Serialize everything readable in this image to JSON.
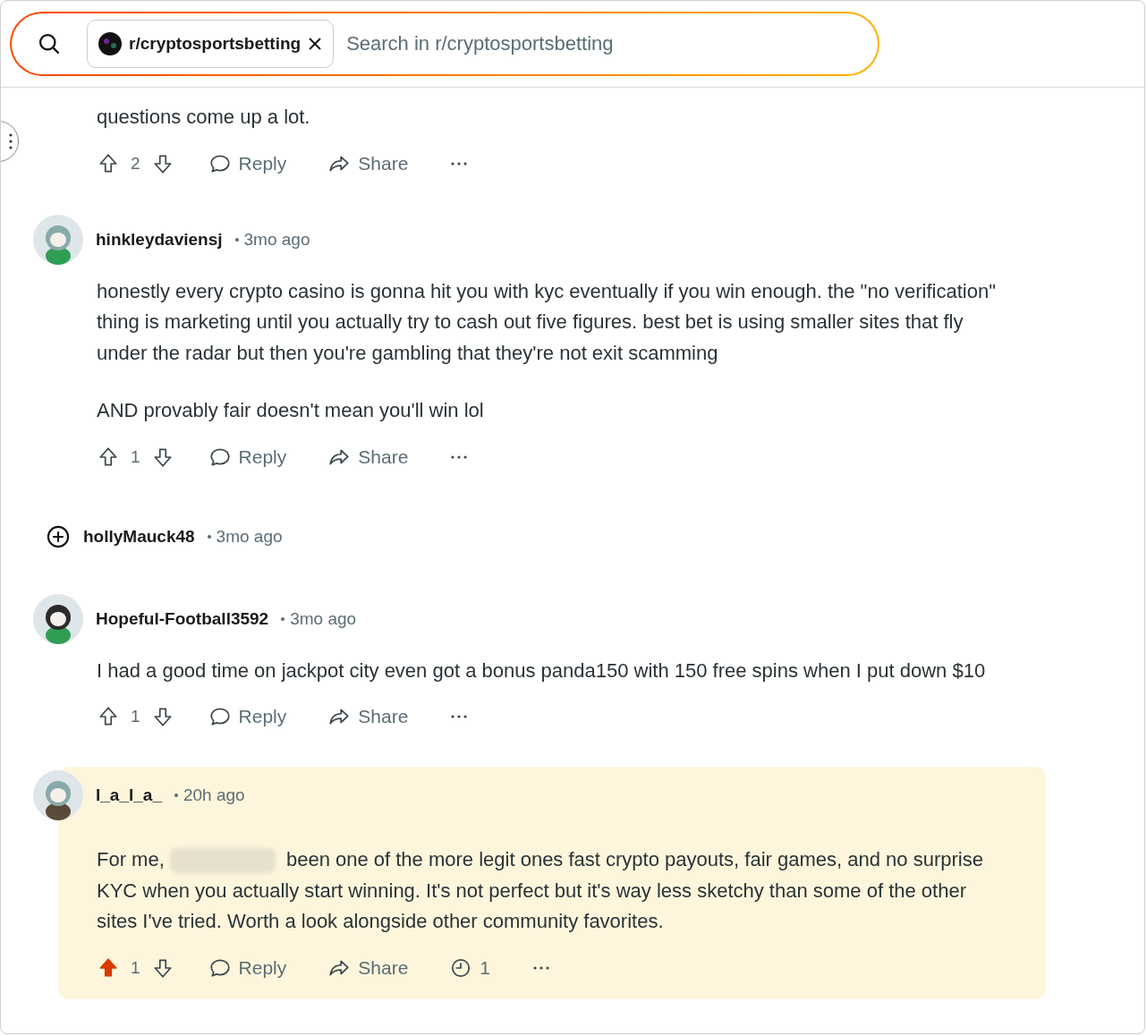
{
  "search": {
    "community": "r/cryptosportsbetting",
    "placeholder": "Search in r/cryptosportsbetting"
  },
  "comments": [
    {
      "kind": "tail",
      "highlighted": false,
      "paragraphs": [
        [
          {
            "kind": "text",
            "text": "questions come up a lot."
          }
        ]
      ],
      "actions": {
        "votes": "2",
        "upvoted": false,
        "reply": "Reply",
        "share": "Share"
      }
    },
    {
      "kind": "full",
      "highlighted": false,
      "author": "hinkleydaviensj",
      "time": "3mo ago",
      "paragraphs": [
        [
          {
            "kind": "text",
            "text": "honestly every crypto casino is gonna hit you with kyc eventually if you win enough. the \"no verification\" thing is marketing until you actually try to cash out five figures. best bet is using smaller sites that fly under the radar but then you're gambling that they're not exit scamming"
          }
        ],
        [
          {
            "kind": "text",
            "text": "AND provably fair doesn't mean you'll win lol"
          }
        ]
      ],
      "actions": {
        "votes": "1",
        "upvoted": false,
        "reply": "Reply",
        "share": "Share"
      }
    },
    {
      "kind": "collapsed",
      "highlighted": false,
      "author": "hollyMauck48",
      "time": "3mo ago"
    },
    {
      "kind": "full",
      "highlighted": false,
      "author": "Hopeful-Football3592",
      "time": "3mo ago",
      "paragraphs": [
        [
          {
            "kind": "text",
            "text": "I had a good time on jackpot city even got a bonus panda150 with 150 free spins when I put down $10"
          }
        ]
      ],
      "actions": {
        "votes": "1",
        "upvoted": false,
        "reply": "Reply",
        "share": "Share"
      }
    },
    {
      "kind": "full",
      "highlighted": true,
      "author": "l_a_l_a_",
      "time": "20h ago",
      "paragraphs": [
        [
          {
            "kind": "text",
            "text": "For me,"
          },
          {
            "kind": "redacted"
          },
          {
            "kind": "text",
            "text": "been one of the more legit ones fast crypto payouts, fair games, and no surprise KYC when you actually start winning. It's not perfect but it's way less sketchy than some of the other sites I've tried. Worth a look alongside other community favorites."
          }
        ]
      ],
      "actions": {
        "votes": "1",
        "upvoted": true,
        "reply": "Reply",
        "share": "Share",
        "awards": "1"
      }
    }
  ]
}
